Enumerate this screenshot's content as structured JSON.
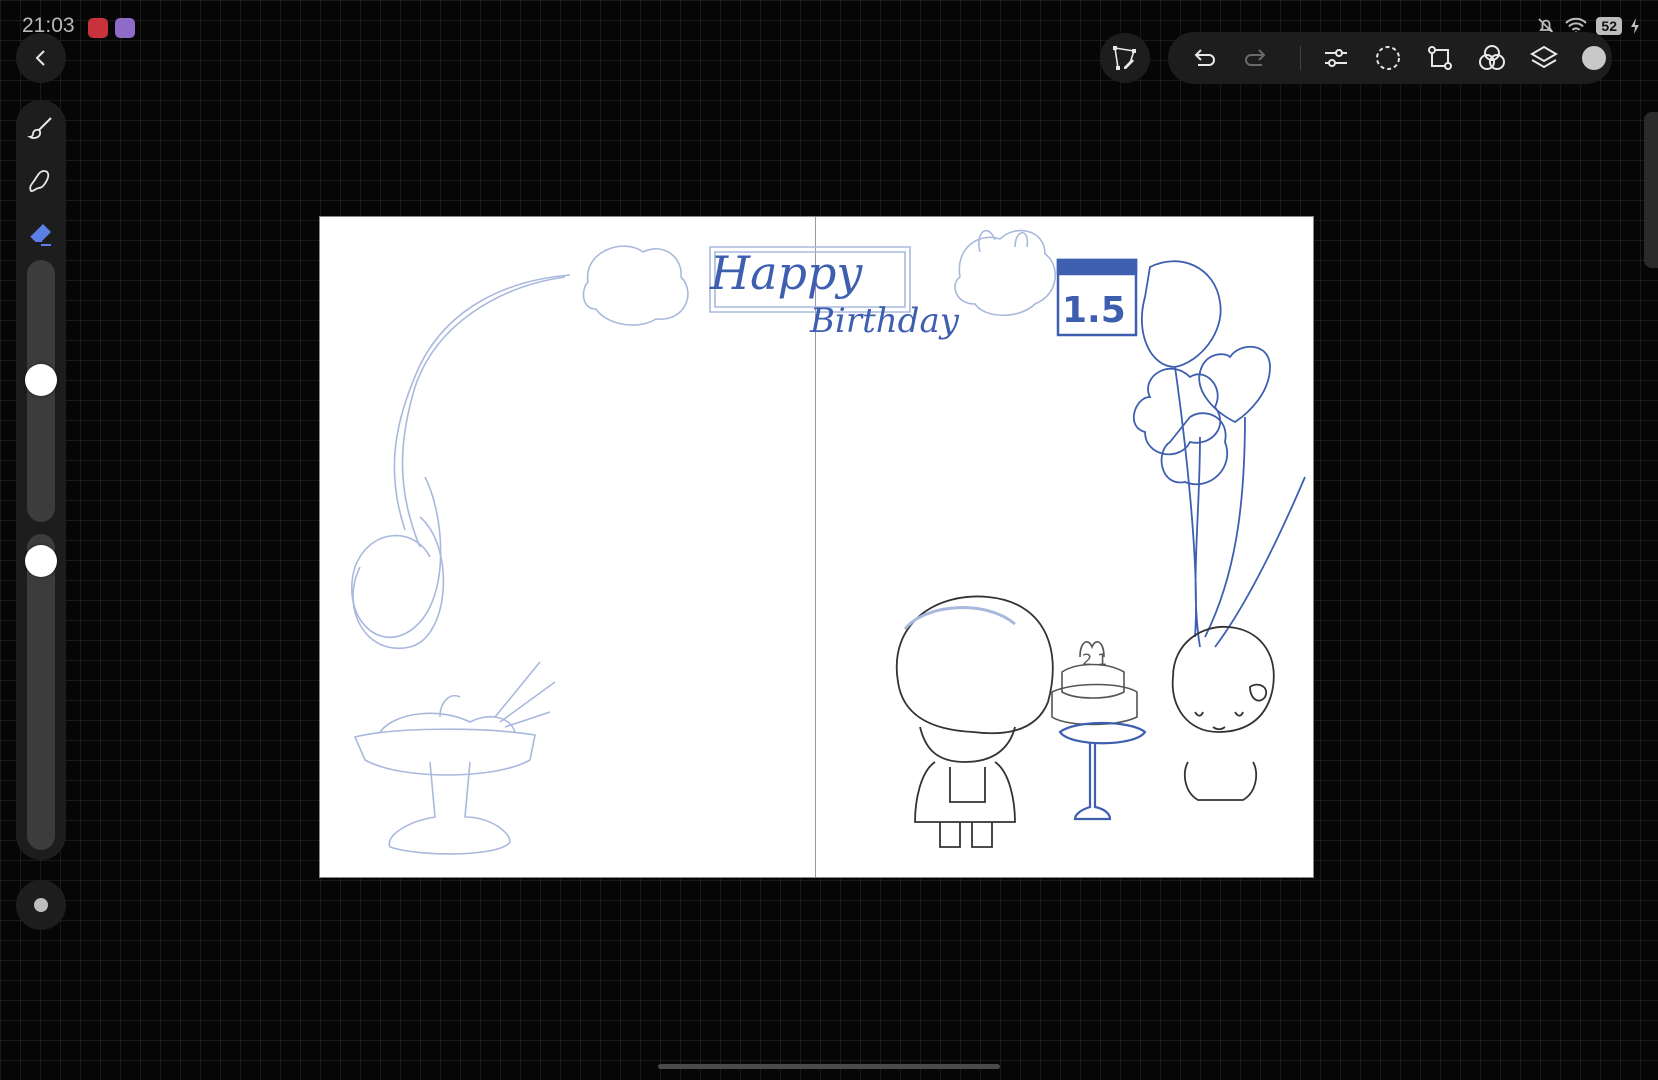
{
  "status": {
    "time": "21:03",
    "battery": "52"
  },
  "colors": {
    "accent": "#5b7fe6",
    "sketch_light": "#a9b9dd",
    "sketch_blue": "#3e5fb0",
    "sketch_dark": "#333333"
  },
  "icons": {
    "back": "chevron-left-icon",
    "brush": "brush-icon",
    "smudge": "smudge-icon",
    "eraser": "eraser-icon",
    "modify": "modify-button-icon",
    "selection_edit": "selection-edit-icon",
    "undo": "undo-icon",
    "redo": "redo-icon",
    "adjustments": "adjustments-icon",
    "selection": "selection-icon",
    "transform": "transform-icon",
    "blend": "blend-icon",
    "layers": "layers-icon",
    "color": "color-swatch-icon"
  },
  "sliders": {
    "brush_size": 0.45,
    "brush_opacity": 0.96
  },
  "artwork": {
    "headline_1": "Happy",
    "headline_2": "Birthday",
    "calendar_number": "1.5",
    "cake_topper": "2 1"
  }
}
